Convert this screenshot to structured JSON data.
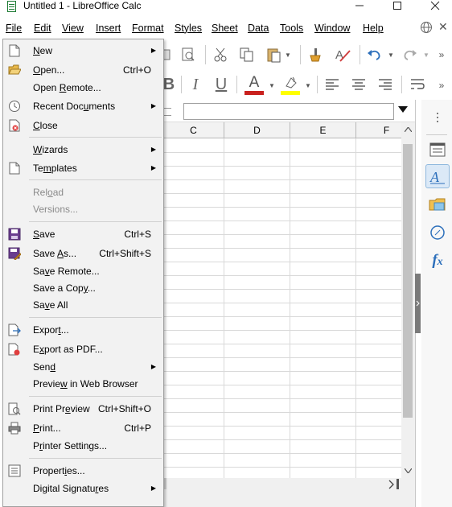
{
  "window": {
    "title": "Untitled 1 - LibreOffice Calc",
    "minimize": "—",
    "maximize": "☐",
    "close": "✕"
  },
  "menubar": {
    "items": [
      {
        "label": "File"
      },
      {
        "label": "Edit"
      },
      {
        "label": "View"
      },
      {
        "label": "Insert"
      },
      {
        "label": "Format"
      },
      {
        "label": "Styles"
      },
      {
        "label": "Sheet"
      },
      {
        "label": "Data"
      },
      {
        "label": "Tools"
      },
      {
        "label": "Window"
      },
      {
        "label": "Help"
      }
    ],
    "globe_icon": "globe-icon",
    "close_doc": "✕"
  },
  "formatting": {
    "bold": "B",
    "italic": "I",
    "underline": "U",
    "font_color_glyph": "A",
    "font_color": "#c9211e",
    "highlight_color": "#ffff00"
  },
  "grid": {
    "columns": [
      "C",
      "D",
      "E",
      "F"
    ]
  },
  "file_menu": {
    "items": [
      {
        "label": "New",
        "icon": "new-document-icon",
        "submenu": true
      },
      {
        "label": "Open...",
        "shortcut": "Ctrl+O",
        "icon": "open-folder-icon"
      },
      {
        "label": "Open Remote...",
        "shortcut": ""
      },
      {
        "label": "Recent Documents",
        "icon": "clock-icon",
        "submenu": true
      },
      {
        "label": "Close",
        "icon": "close-document-icon"
      },
      {
        "label": "Wizards",
        "submenu": true
      },
      {
        "label": "Templates",
        "icon": "template-icon",
        "submenu": true
      },
      {
        "label": "Reload",
        "disabled": true
      },
      {
        "label": "Versions...",
        "disabled": true
      },
      {
        "label": "Save",
        "shortcut": "Ctrl+S",
        "icon": "save-icon"
      },
      {
        "label": "Save As...",
        "shortcut": "Ctrl+Shift+S",
        "icon": "save-as-icon"
      },
      {
        "label": "Save Remote..."
      },
      {
        "label": "Save a Copy..."
      },
      {
        "label": "Save All"
      },
      {
        "label": "Export...",
        "icon": "export-icon"
      },
      {
        "label": "Export as PDF...",
        "icon": "pdf-icon"
      },
      {
        "label": "Send",
        "submenu": true
      },
      {
        "label": "Preview in Web Browser"
      },
      {
        "label": "Print Preview",
        "shortcut": "Ctrl+Shift+O",
        "icon": "print-preview-icon"
      },
      {
        "label": "Print...",
        "shortcut": "Ctrl+P",
        "icon": "printer-icon"
      },
      {
        "label": "Printer Settings..."
      },
      {
        "label": "Properties...",
        "icon": "properties-icon"
      },
      {
        "label": "Digital Signatures",
        "submenu": true
      }
    ],
    "submenu_arrow": "▶"
  }
}
